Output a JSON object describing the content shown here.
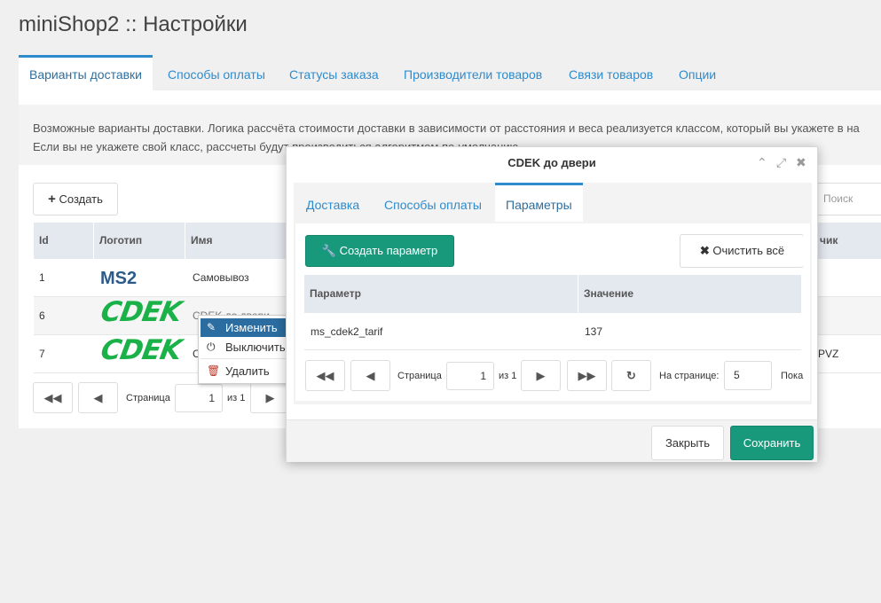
{
  "page": {
    "title": "miniShop2 :: Настройки"
  },
  "tabs": [
    "Варианты доставки",
    "Способы оплаты",
    "Статусы заказа",
    "Производители товаров",
    "Связи товаров",
    "Опции"
  ],
  "description": {
    "line1": "Возможные варианты доставки. Логика рассчёта стоимости доставки в зависимости от расстояния и веса реализуется классом, который вы укажете в на",
    "line2": "Если вы не укажете свой класс, рассчеты будут производиться алгоритмом по-умолчанию."
  },
  "toolbar": {
    "create_label": "Создать",
    "search_placeholder": "Поиск"
  },
  "grid": {
    "columns": [
      "Id",
      "Логотип",
      "Имя",
      "чик"
    ],
    "rows": [
      {
        "id": "1",
        "logo": "MS2",
        "name": "Самовывоз",
        "extra": ""
      },
      {
        "id": "6",
        "logo": "CDEK",
        "name": "CDEK до двери",
        "extra": ""
      },
      {
        "id": "7",
        "logo": "CDEK",
        "name": "C",
        "extra": "PVZ"
      }
    ]
  },
  "pager": {
    "page_label": "Страница",
    "page_value": "1",
    "of_label": "из 1"
  },
  "context_menu": {
    "edit": "Изменить",
    "disable": "Выключить",
    "delete": "Удалить"
  },
  "modal": {
    "title": "CDEK до двери",
    "tabs": [
      "Доставка",
      "Способы оплаты",
      "Параметры"
    ],
    "create_param_label": "Создать параметр",
    "clear_all_label": "Очистить всё",
    "columns": [
      "Параметр",
      "Значение"
    ],
    "rows": [
      {
        "param": "ms_cdek2_tarif",
        "value": "137"
      }
    ],
    "pager": {
      "page_label": "Страница",
      "page_value": "1",
      "of_label": "из 1",
      "per_page_label": "На странице:",
      "per_page_value": "5",
      "showing_label": "Пока"
    },
    "close_label": "Закрыть",
    "save_label": "Сохранить"
  },
  "colors": {
    "accent": "#2e8bcc",
    "green": "#19997c",
    "cdek": "#1ab248",
    "highlight": "#2b6da0"
  }
}
